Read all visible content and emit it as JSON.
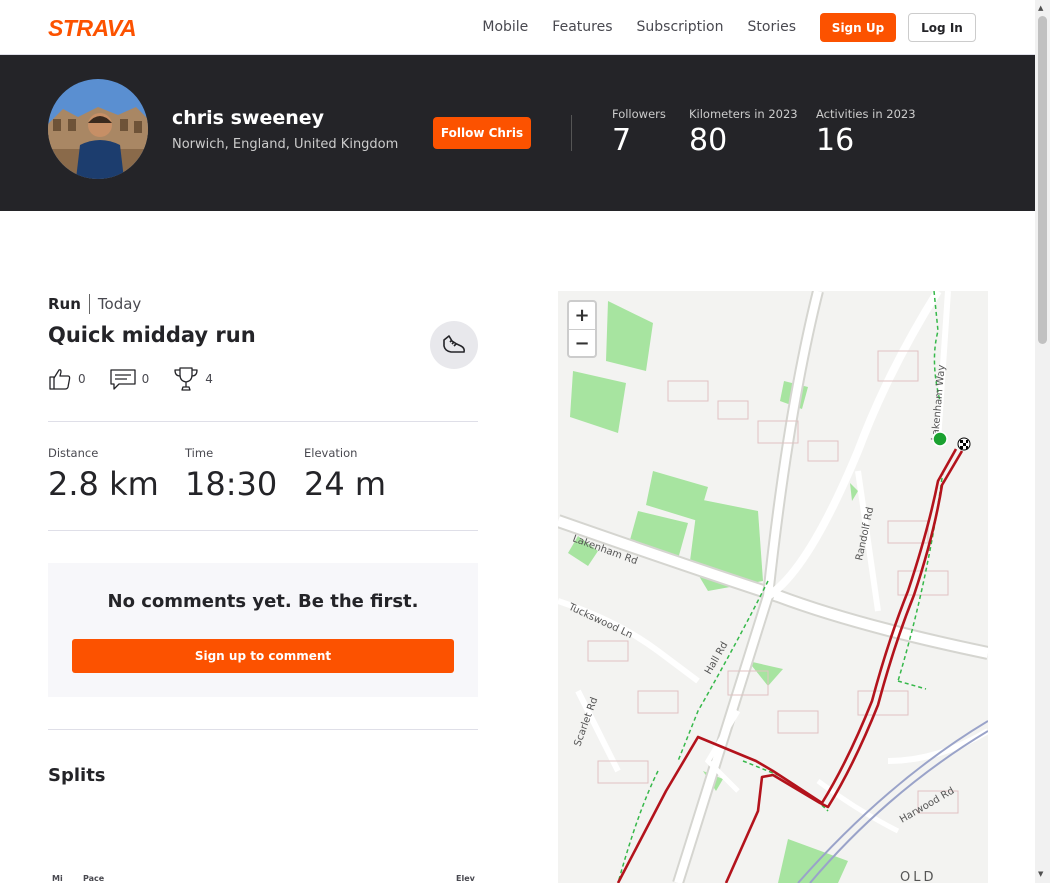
{
  "nav": {
    "logo": "STRAVA",
    "links": [
      "Mobile",
      "Features",
      "Subscription",
      "Stories"
    ],
    "signup_label": "Sign Up",
    "login_label": "Log In"
  },
  "athlete": {
    "name": "chris sweeney",
    "location": "Norwich, England, United Kingdom",
    "follow_label": "Follow Chris",
    "stats": [
      {
        "label": "Followers",
        "value": "7"
      },
      {
        "label": "Kilometers in 2023",
        "value": "80"
      },
      {
        "label": "Activities in 2023",
        "value": "16"
      }
    ]
  },
  "activity": {
    "type": "Run",
    "date": "Today",
    "title": "Quick midday run",
    "kudos": "0",
    "comments": "0",
    "achievements": "4",
    "metrics": [
      {
        "label": "Distance",
        "value": "2.8 km"
      },
      {
        "label": "Time",
        "value": "18:30"
      },
      {
        "label": "Elevation",
        "value": "24 m"
      }
    ]
  },
  "comments": {
    "empty_text": "No comments yet. Be the first.",
    "signup_label": "Sign up to comment"
  },
  "splits": {
    "title": "Splits",
    "headers": [
      "Mi",
      "Pace",
      "Elev"
    ]
  },
  "map": {
    "zoom_in": "+",
    "zoom_out": "−",
    "labels": [
      "Lakenham Rd",
      "Tuckswood Ln",
      "Hall Rd",
      "Scarlet Rd",
      "Randolf Rd",
      "Harwood Rd",
      "Lakenham Way",
      "OLD"
    ]
  },
  "colors": {
    "brand": "#fc5200",
    "hero_bg": "#242428",
    "route": "#b3131c",
    "park": "#a7e4a0"
  }
}
